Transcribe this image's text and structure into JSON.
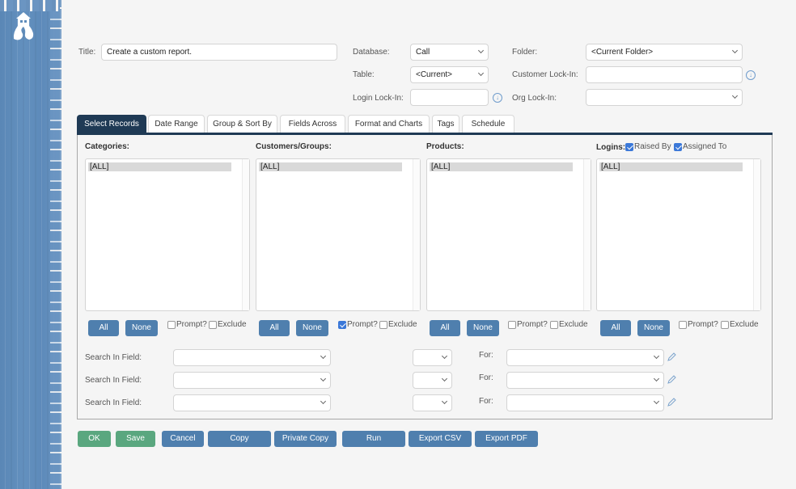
{
  "brand": {
    "logo_icon": "lighthouse-logo-icon",
    "stripe_color": "#5f8cbb"
  },
  "header": {
    "title_label": "Title:",
    "title_value": "Create a custom report.",
    "database_label": "Database:",
    "database_value": "Call",
    "table_label": "Table:",
    "table_value": "<Current>",
    "login_lockin_label": "Login Lock-In:",
    "login_lockin_value": "",
    "folder_label": "Folder:",
    "folder_value": "<Current Folder>",
    "customer_lockin_label": "Customer Lock-In:",
    "customer_lockin_value": "",
    "org_lockin_label": "Org Lock-In:",
    "org_lockin_value": ""
  },
  "tabs": [
    {
      "label": "Select Records",
      "active": true
    },
    {
      "label": "Date Range",
      "active": false
    },
    {
      "label": "Group & Sort By",
      "active": false
    },
    {
      "label": "Fields Across",
      "active": false
    },
    {
      "label": "Format and Charts",
      "active": false
    },
    {
      "label": "Tags",
      "active": false
    },
    {
      "label": "Schedule",
      "active": false
    }
  ],
  "columns": [
    {
      "heading": "Categories:",
      "items": [
        "[ALL]"
      ],
      "all_label": "All",
      "none_label": "None",
      "prompt_label": "Prompt?",
      "prompt_checked": false,
      "exclude_label": "Exclude",
      "exclude_checked": false
    },
    {
      "heading": "Customers/Groups:",
      "items": [
        "[ALL]"
      ],
      "all_label": "All",
      "none_label": "None",
      "prompt_label": "Prompt?",
      "prompt_checked": true,
      "exclude_label": "Exclude",
      "exclude_checked": false
    },
    {
      "heading": "Products:",
      "items": [
        "[ALL]"
      ],
      "all_label": "All",
      "none_label": "None",
      "prompt_label": "Prompt?",
      "prompt_checked": false,
      "exclude_label": "Exclude",
      "exclude_checked": false
    },
    {
      "heading": "Logins:",
      "items": [
        "[ALL]"
      ],
      "all_label": "All",
      "none_label": "None",
      "prompt_label": "Prompt?",
      "prompt_checked": false,
      "exclude_label": "Exclude",
      "exclude_checked": false
    }
  ],
  "logins_options": {
    "raised_by_label": "Raised By",
    "raised_by_checked": true,
    "assigned_to_label": "Assigned To",
    "assigned_to_checked": true
  },
  "search_rows": [
    {
      "label": "Search In Field:",
      "field_value": "",
      "operator_value": "",
      "for_label": "For:",
      "for_value": ""
    },
    {
      "label": "Search In Field:",
      "field_value": "",
      "operator_value": "",
      "for_label": "For:",
      "for_value": ""
    },
    {
      "label": "Search In Field:",
      "field_value": "",
      "operator_value": "",
      "for_label": "For:",
      "for_value": ""
    }
  ],
  "actions": {
    "ok": "OK",
    "save": "Save",
    "cancel": "Cancel",
    "copy": "Copy",
    "private_copy": "Private Copy",
    "run": "Run",
    "export_csv": "Export CSV",
    "export_pdf": "Export PDF"
  },
  "colors": {
    "primary_button": "#4f7fae",
    "success_button": "#5aa77f",
    "active_tab": "#1f3a55",
    "checkbox": "#3b78d8"
  }
}
